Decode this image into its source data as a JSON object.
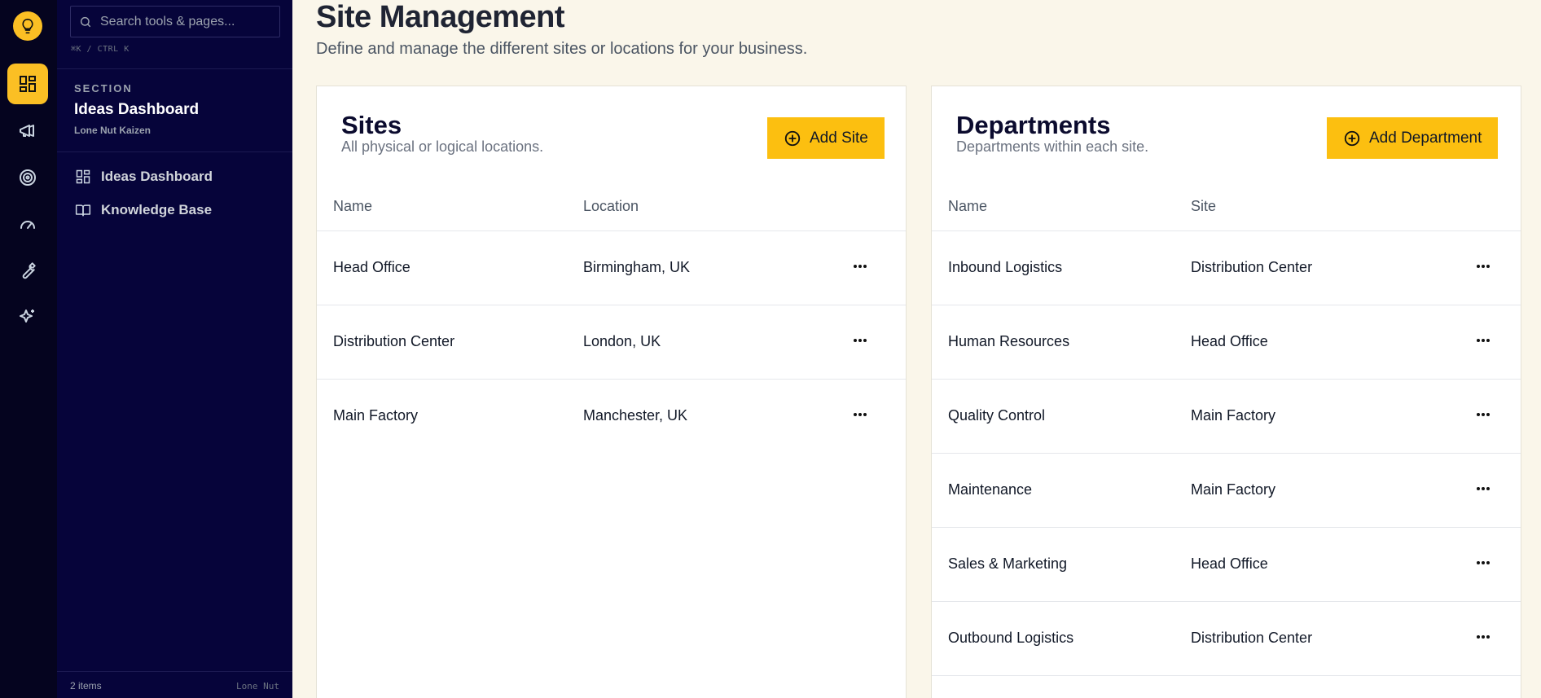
{
  "rail": {
    "items": [
      {
        "icon": "dashboard-icon",
        "active": true
      },
      {
        "icon": "megaphone-icon",
        "active": false
      },
      {
        "icon": "target-icon",
        "active": false
      },
      {
        "icon": "gauge-icon",
        "active": false
      },
      {
        "icon": "wrench-icon",
        "active": false
      },
      {
        "icon": "sparkles-icon",
        "active": false
      }
    ]
  },
  "sidebar": {
    "search_placeholder": "Search tools & pages...",
    "shortcut": "⌘K / CTRL K",
    "section_label": "SECTION",
    "section_title": "Ideas Dashboard",
    "section_sub": "Lone Nut Kaizen",
    "items": [
      {
        "label": "Ideas Dashboard",
        "icon": "grid-icon"
      },
      {
        "label": "Knowledge Base",
        "icon": "book-icon"
      }
    ],
    "footer_count": "2 items",
    "footer_brand": "Lone Nut"
  },
  "main": {
    "title": "Site Management",
    "subtitle": "Define and manage the different sites or locations for your business."
  },
  "sites": {
    "title": "Sites",
    "subtitle": "All physical or logical locations.",
    "add_label": "Add Site",
    "columns": [
      "Name",
      "Location"
    ],
    "rows": [
      [
        "Head Office",
        "Birmingham, UK"
      ],
      [
        "Distribution Center",
        "London, UK"
      ],
      [
        "Main Factory",
        "Manchester, UK"
      ]
    ]
  },
  "departments": {
    "title": "Departments",
    "subtitle": "Departments within each site.",
    "add_label": "Add Department",
    "columns": [
      "Name",
      "Site"
    ],
    "rows": [
      [
        "Inbound Logistics",
        "Distribution Center"
      ],
      [
        "Human Resources",
        "Head Office"
      ],
      [
        "Quality Control",
        "Main Factory"
      ],
      [
        "Maintenance",
        "Main Factory"
      ],
      [
        "Sales & Marketing",
        "Head Office"
      ],
      [
        "Outbound Logistics",
        "Distribution Center"
      ]
    ]
  },
  "colors": {
    "accent": "#fcbf10",
    "rail_bg": "#05041f",
    "sidebar_bg": "#06043a",
    "page_bg": "#faf6ea"
  }
}
